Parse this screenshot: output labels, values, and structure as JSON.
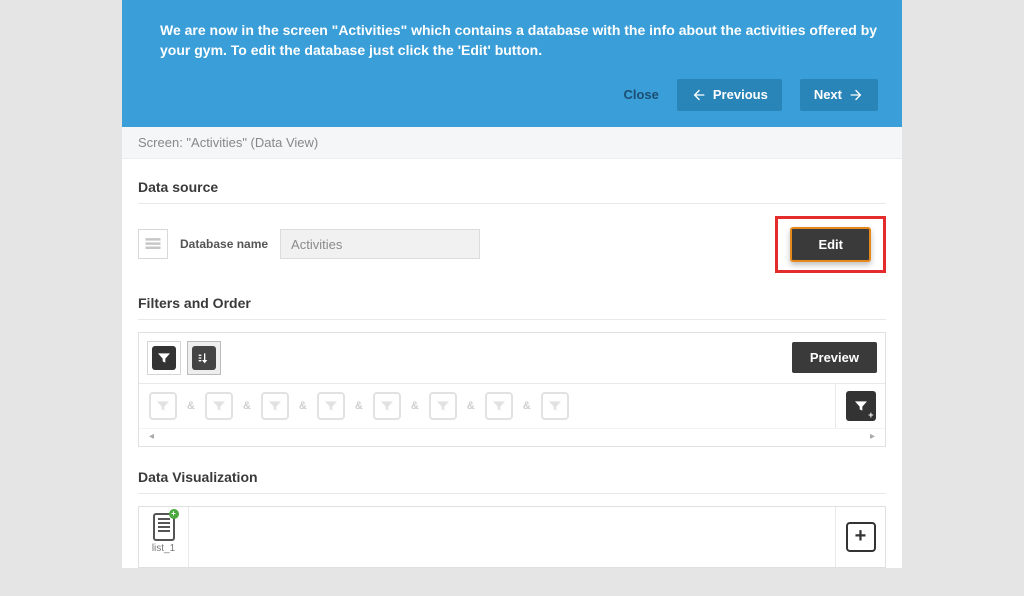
{
  "banner": {
    "text": "We are now in the screen \"Activities\" which contains a database with the info about the activities offered by your gym.  To edit the database just click the 'Edit' button.",
    "close_label": "Close",
    "previous_label": "Previous",
    "next_label": "Next"
  },
  "subheader": {
    "text": "Screen: \"Activities\" (Data View)"
  },
  "datasource": {
    "section_title": "Data source",
    "db_label": "Database name",
    "db_value": "Activities",
    "edit_label": "Edit"
  },
  "filters": {
    "section_title": "Filters and Order",
    "preview_label": "Preview",
    "and_label": "&",
    "slot_icon": "filter-icon",
    "sort_icon": "sort-icon"
  },
  "viz": {
    "section_title": "Data Visualization",
    "tab_name": "list_1",
    "add_label": "+"
  }
}
